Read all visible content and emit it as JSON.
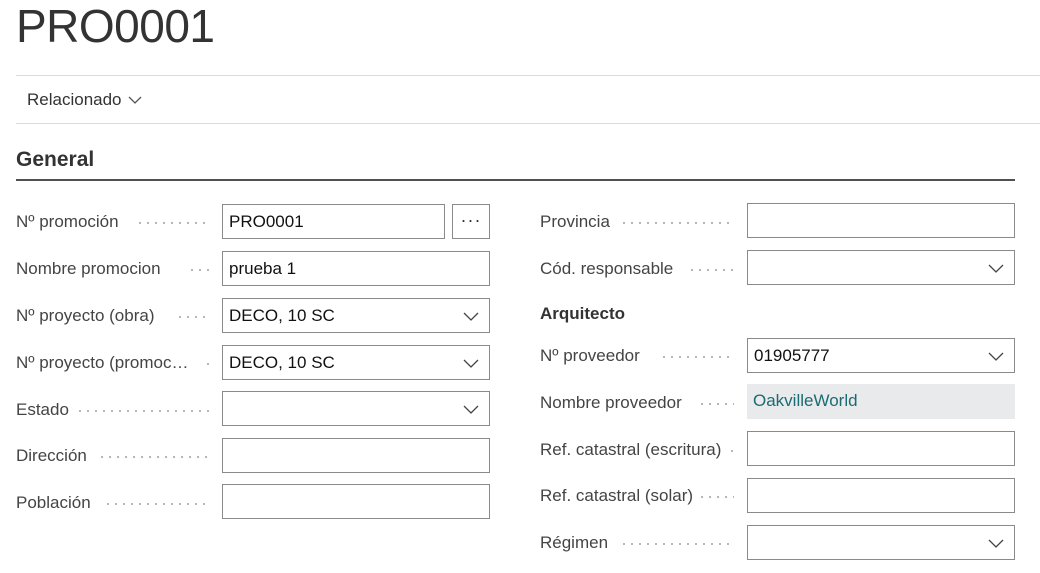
{
  "page": {
    "title": "PRO0001"
  },
  "actions": {
    "related": "Relacionado"
  },
  "section": {
    "title": "General"
  },
  "left_fields": {
    "no_promocion": {
      "label": "Nº promoción",
      "value": "PRO0001"
    },
    "nombre_promocion": {
      "label": "Nombre promocion",
      "value": "prueba 1"
    },
    "no_proyecto_obra": {
      "label": "Nº proyecto (obra)",
      "value": "DECO, 10 SC"
    },
    "no_proyecto_promocion": {
      "label": "Nº proyecto (promoc…",
      "value": "DECO, 10 SC"
    },
    "estado": {
      "label": "Estado",
      "value": ""
    },
    "direccion": {
      "label": "Dirección",
      "value": ""
    },
    "poblacion": {
      "label": "Población",
      "value": ""
    }
  },
  "right_fields": {
    "provincia": {
      "label": "Provincia",
      "value": ""
    },
    "cod_responsable": {
      "label": "Cód. responsable",
      "value": ""
    },
    "arquitecto": "Arquitecto",
    "no_proveedor": {
      "label": "Nº proveedor",
      "value": "01905777"
    },
    "nombre_proveedor": {
      "label": "Nombre proveedor",
      "value": "OakvilleWorld"
    },
    "ref_catastral_escritura": {
      "label": "Ref. catastral (escritura)",
      "value": ""
    },
    "ref_catastral_solar": {
      "label": "Ref. catastral (solar)",
      "value": ""
    },
    "regimen": {
      "label": "Régimen",
      "value": ""
    }
  },
  "icons": {
    "dropdown": "chevron-down-icon",
    "lookup": "ellipsis-icon"
  },
  "colors": {
    "link_value": "#1b6b72",
    "readonly_bg": "#e9eaeb"
  }
}
